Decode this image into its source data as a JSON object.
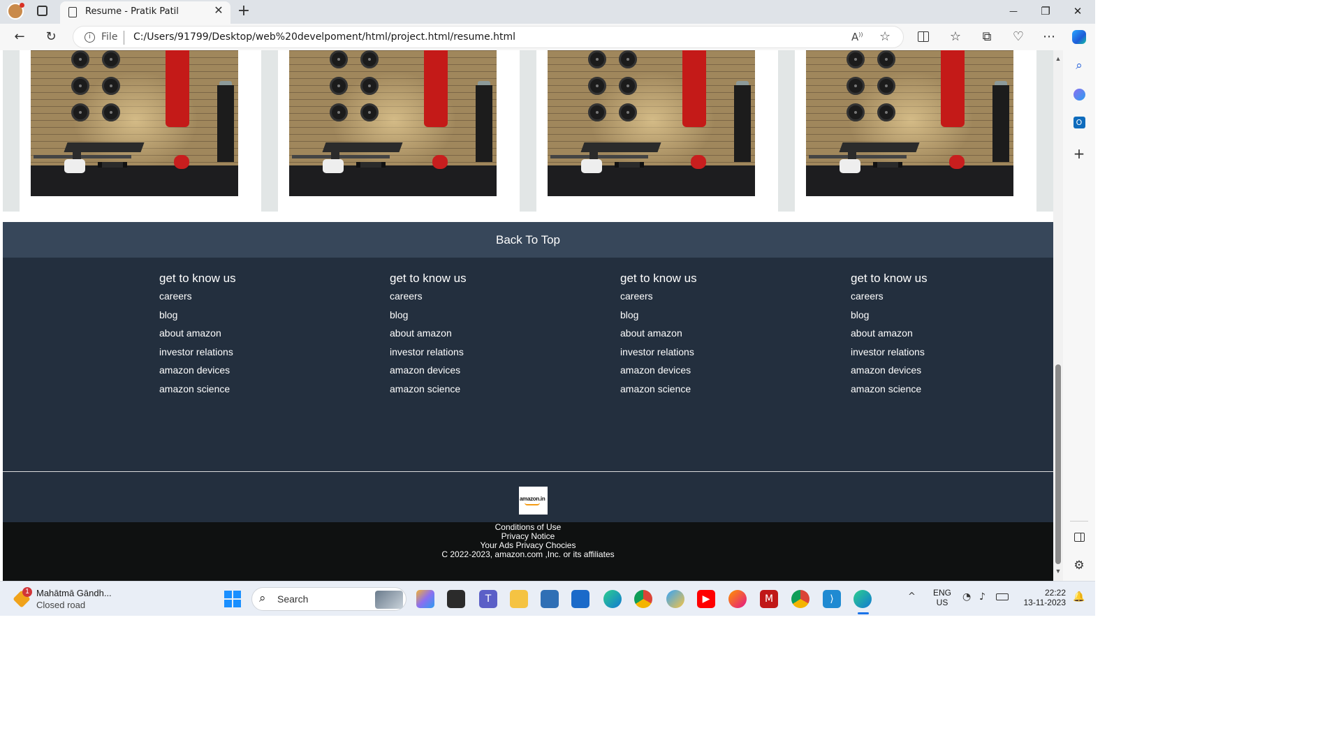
{
  "browser": {
    "tab_title": "Resume - Pratik Patil",
    "tab_close": "✕",
    "new_tab": "+",
    "address_scheme": "File",
    "address_url": "C:/Users/91799/Desktop/web%20develpoment/html/project.html/resume.html",
    "window_controls": {
      "minimize": "—",
      "maximize": "❐",
      "close": "✕"
    },
    "icons": [
      "back-icon",
      "refresh-icon",
      "info-icon",
      "read-aloud-icon",
      "favorite-star-icon",
      "split-screen-icon",
      "favorites-icon",
      "collections-icon",
      "browser-essentials-icon",
      "more-icon",
      "copilot-icon"
    ]
  },
  "sidebar": {
    "icons": [
      "search-icon",
      "copilot-icon",
      "outlook-icon",
      "add-icon",
      "panel-icon",
      "settings-icon"
    ]
  },
  "page": {
    "gallery": {
      "image_count": 4
    },
    "back_to_top": "Back To Top",
    "footer_columns": [
      {
        "heading": "get to know us",
        "links": [
          "careers",
          "blog",
          "about amazon",
          "investor relations",
          "amazon devices",
          "amazon science"
        ]
      },
      {
        "heading": "get to know us",
        "links": [
          "careers",
          "blog",
          "about amazon",
          "investor relations",
          "amazon devices",
          "amazon science"
        ]
      },
      {
        "heading": "get to know us",
        "links": [
          "careers",
          "blog",
          "about amazon",
          "investor relations",
          "amazon devices",
          "amazon science"
        ]
      },
      {
        "heading": "get to know us",
        "links": [
          "careers",
          "blog",
          "about amazon",
          "investor relations",
          "amazon devices",
          "amazon science"
        ]
      }
    ],
    "logo_text": "amazon.in",
    "legal_links": [
      "Conditions of Use",
      "Privacy Notice",
      "Your Ads Privacy Chocies"
    ],
    "copyright": "C 2022-2023, amazon.com ,Inc. or its affiliates"
  },
  "taskbar": {
    "notification_title": "Mahātmā Gāndh...",
    "notification_subtitle": "Closed road",
    "notification_badge": "1",
    "search_label": "Search",
    "language_line1": "ENG",
    "language_line2": "US",
    "time": "22:22",
    "date": "13-11-2023",
    "apps": [
      "start-icon",
      "copilot-icon",
      "task-view-icon",
      "teams-icon",
      "file-explorer-icon",
      "remote-desktop-icon",
      "store-icon",
      "edge-icon",
      "chrome-icon",
      "copilot-app-icon",
      "youtube-icon",
      "firefox-icon",
      "mcafee-icon",
      "chrome-profile-icon",
      "vscode-icon",
      "edge-active-icon"
    ],
    "colors": {
      "taskbar_bg": "#e9eef6"
    }
  },
  "colors": {
    "back_to_top_bg": "#37475a",
    "footer_bg": "#232f3e",
    "footer_bottom_bg": "#0f1111",
    "gallery_strip": "#e2e6e6"
  }
}
